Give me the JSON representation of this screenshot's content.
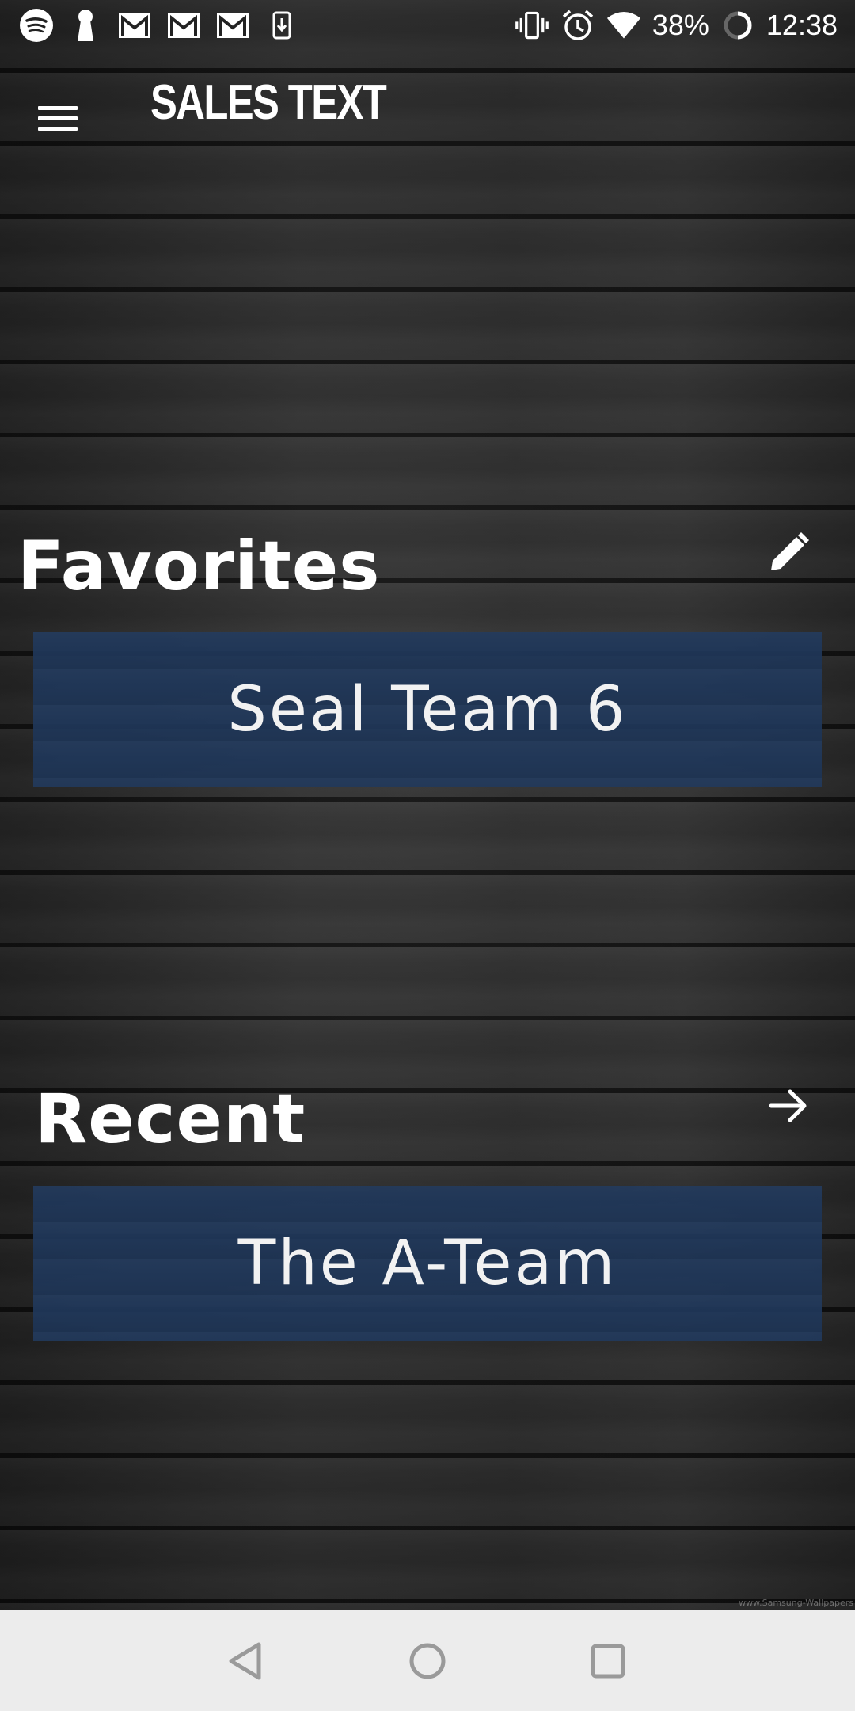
{
  "status_bar": {
    "battery_percent": "38%",
    "time": "12:38",
    "left_icons": [
      "spotify-icon",
      "keyhole-icon",
      "gmail-icon",
      "gmail-icon",
      "gmail-icon",
      "download-icon"
    ],
    "right_icons": [
      "vibrate-icon",
      "alarm-icon",
      "wifi-icon",
      "battery-icon"
    ]
  },
  "app_bar": {
    "title": "SALES TEXT",
    "menu_icon": "hamburger-menu-icon"
  },
  "favorites": {
    "title": "Favorites",
    "action_icon": "edit-pencil-icon",
    "items": [
      {
        "label": "Seal Team 6"
      }
    ]
  },
  "recent": {
    "title": "Recent",
    "action_icon": "arrow-right-icon",
    "items": [
      {
        "label": "The A-Team"
      }
    ]
  },
  "background": {
    "watermark": "www.Samsung-Wallpapers"
  },
  "nav_bar": {
    "icons": [
      "back-icon",
      "home-icon",
      "recents-icon"
    ]
  },
  "colors": {
    "card_background": "#20375a",
    "text": "#ffffff",
    "nav_bar_background": "#ececec"
  }
}
